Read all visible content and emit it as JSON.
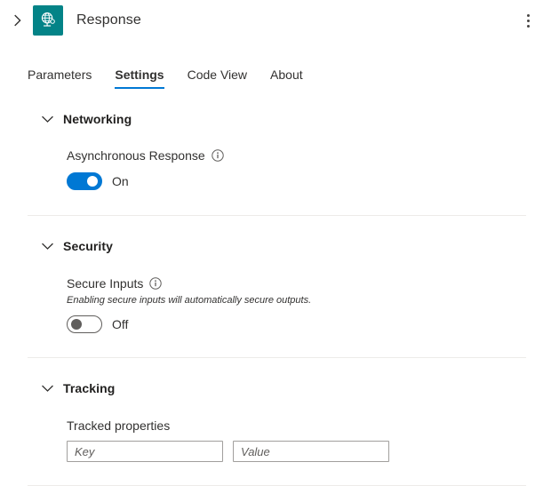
{
  "header": {
    "expand_icon": "chevron-right-icon",
    "node_icon": "response-globe-icon",
    "node_icon_color": "#038387",
    "title": "Response",
    "overflow_icon": "more-vertical-icon"
  },
  "tabs": [
    {
      "label": "Parameters",
      "active": false
    },
    {
      "label": "Settings",
      "active": true
    },
    {
      "label": "Code View",
      "active": false
    },
    {
      "label": "About",
      "active": false
    }
  ],
  "accent_color": "#0078d4",
  "sections": {
    "networking": {
      "title": "Networking",
      "chevron_icon": "chevron-down-icon",
      "async_response": {
        "label": "Asynchronous Response",
        "info_icon": "info-circle-icon",
        "toggle_state": "On",
        "toggle_on": true
      }
    },
    "security": {
      "title": "Security",
      "chevron_icon": "chevron-down-icon",
      "secure_inputs": {
        "label": "Secure Inputs",
        "info_icon": "info-circle-icon",
        "description": "Enabling secure inputs will automatically secure outputs.",
        "toggle_state": "Off",
        "toggle_on": false
      }
    },
    "tracking": {
      "title": "Tracking",
      "chevron_icon": "chevron-down-icon",
      "tracked_properties": {
        "label": "Tracked properties",
        "key_placeholder": "Key",
        "key_value": "",
        "value_placeholder": "Value",
        "value_value": ""
      }
    }
  }
}
